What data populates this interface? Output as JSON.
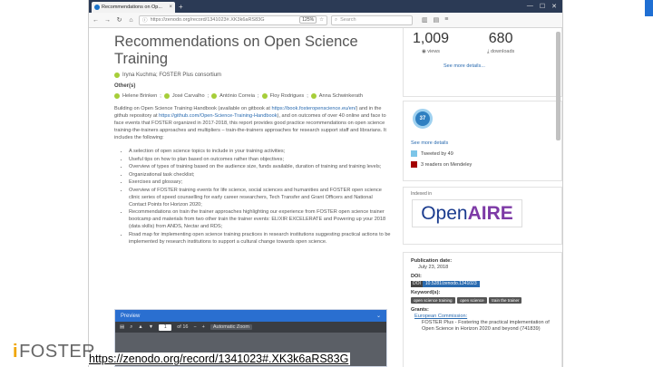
{
  "browser": {
    "tab_title": "Recommendations on Op...",
    "url": "https://zenodo.org/record/1341023#.XK3k6aRS83G",
    "zoom": "125%",
    "search_placeholder": "Search"
  },
  "record": {
    "title": "Recommendations on Open Science Training",
    "authors": "Iryna Kuchma; FOSTER Plus consortium",
    "others_label": "Other(s)",
    "others": [
      "Helene Brinken",
      "José Carvalho",
      "António Correia",
      "Floy Rodrigues",
      "Anna Schwinkerath"
    ],
    "description_1": "Building on Open Science Training Handbook (available on gitbook at ",
    "description_link_1": "https://book.fosteropenscience.eu/en/",
    "description_2": ") and in the github repository at ",
    "description_link_2": "https://github.com/Open-Science-Training-Handbook",
    "description_3": "), and on outcomes of over 40 online and face to face events that FOSTER organized in 2017-2018, this report provides good practice recommendations on open science training-the-trainers approaches and multipliers – train-the-trainers approaches for research support staff and librarians. It includes the following:",
    "bullets": [
      "A selection of open science topics to include in your training activities;",
      "Useful tips on how to plan based on outcomes rather than objectives;",
      "Overview of types of training based on the audience size, funds available, duration of training and training levels;",
      "Organizational task checklist;",
      "Exercises and glossary;",
      "Overview of FOSTER training events for life science, social sciences and humanities and FOSTER open science clinic series of speed counselling for early career researchers, Tech Transfer and Grant Officers and National Contact Points for Horizon 2020;",
      "Recommendations on train the trainer approaches highlighting our experience from FOSTER open science trainer bootcamp and materials from two other train the trainer events: ELIXIR EXCELERATE and Powering up your 2018 (data skills) from ANDS, Nectar and RDS;",
      "Road map for implementing open science training practices in research institutions suggesting practical actions to be implemented by research institutions to support a cultural change towards open science."
    ]
  },
  "preview": {
    "label": "Preview",
    "page": "1",
    "of_pages": "of 16",
    "zoom": "Automatic Zoom"
  },
  "stats": {
    "views": "1,009",
    "views_label": "views",
    "downloads": "680",
    "downloads_label": "downloads",
    "details_link": "See more details..."
  },
  "altmetric": {
    "score": "37",
    "details_link": "See more details",
    "tweeted": "Tweeted by 49",
    "mendeley": "3 readers on Mendeley",
    "colors": {
      "badge": "#2f7fc1",
      "twitter": "#7cc5e8",
      "mendeley": "#a30000"
    }
  },
  "community": {
    "label": "Indexed in",
    "logo_open": "Open",
    "logo_aire": "AIRE"
  },
  "meta": {
    "publication_label": "Publication date:",
    "publication_date": "July 23, 2018",
    "doi_label": "DOI:",
    "doi_badge": "DOI",
    "doi_value": "10.5281/zenodo.1341023",
    "keywords_label": "Keyword(s):",
    "keywords": [
      "open science training",
      "open science",
      "train the trainer"
    ],
    "grants_label": "Grants:",
    "grant_link": "European Commission:",
    "grant_text": "FOSTER Plus - Fostering the practical implementation of Open Science in Horizon 2020 and beyond (741839)"
  },
  "slide": {
    "logo_i": "i",
    "logo_text": "FOSTER",
    "link_caption": "https://zenodo.org/record/1341023#.XK3k6aRS83G"
  }
}
